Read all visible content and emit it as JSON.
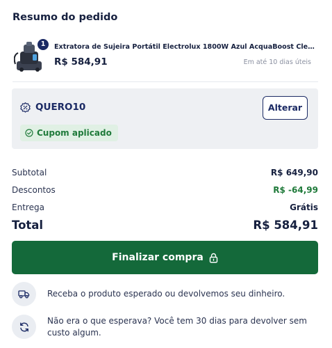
{
  "order": {
    "title": "Resumo do pedido"
  },
  "product": {
    "quantity": "1",
    "name": "Extratora de Sujeira Portátil Electrolux 1800W Azul AcquaBoost Clean ...",
    "price": "R$ 584,91",
    "delivery": "Em até 10 dias úteis"
  },
  "coupon": {
    "code": "QUERO10",
    "change_label": "Alterar",
    "status": "Cupom aplicado"
  },
  "summary": {
    "subtotal_label": "Subtotal",
    "subtotal_value": "R$ 649,90",
    "discount_label": "Descontos",
    "discount_value": "R$ -64,99",
    "shipping_label": "Entrega",
    "shipping_value": "Grátis",
    "total_label": "Total",
    "total_value": "R$ 584,91"
  },
  "checkout": {
    "label": "Finalizar compra"
  },
  "info": [
    {
      "icon": "truck-icon",
      "text": "Receba o produto esperado ou devolvemos seu dinheiro."
    },
    {
      "icon": "refresh-icon",
      "text": "Não era o que esperava? Você tem 30 dias para devolver sem custo algum."
    }
  ],
  "colors": {
    "brand_navy": "#1b2a64",
    "success_green": "#14693a",
    "discount_green": "#1f7a3a",
    "panel_gray": "#eef0f3"
  }
}
